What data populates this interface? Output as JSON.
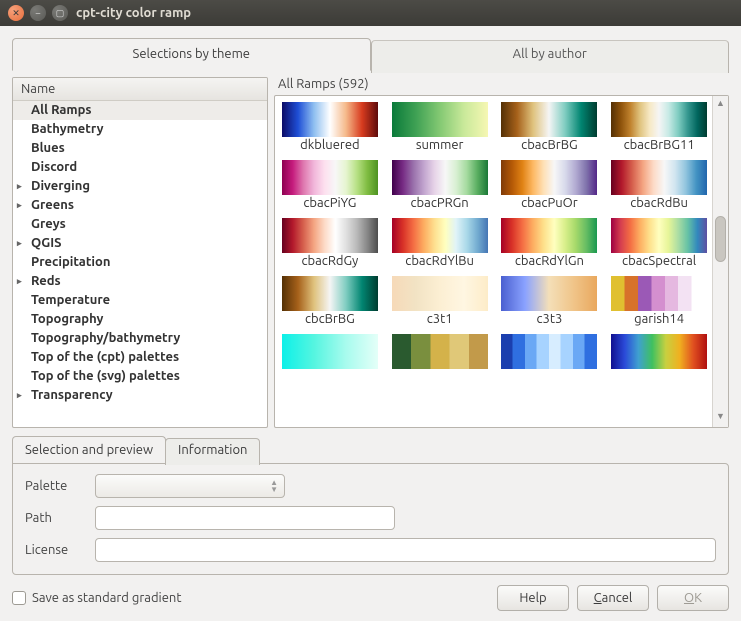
{
  "window": {
    "title": "cpt-city color ramp"
  },
  "tabs": {
    "theme": "Selections by theme",
    "author": "All by author"
  },
  "tree": {
    "header": "Name",
    "items": [
      {
        "label": "All Ramps",
        "expandable": false,
        "selected": true
      },
      {
        "label": "Bathymetry",
        "expandable": false
      },
      {
        "label": "Blues",
        "expandable": false
      },
      {
        "label": "Discord",
        "expandable": false
      },
      {
        "label": "Diverging",
        "expandable": true
      },
      {
        "label": "Greens",
        "expandable": true
      },
      {
        "label": "Greys",
        "expandable": false
      },
      {
        "label": "QGIS",
        "expandable": true
      },
      {
        "label": "Precipitation",
        "expandable": false
      },
      {
        "label": "Reds",
        "expandable": true
      },
      {
        "label": "Temperature",
        "expandable": false
      },
      {
        "label": "Topography",
        "expandable": false
      },
      {
        "label": "Topography/bathymetry",
        "expandable": false
      },
      {
        "label": "Top of the (cpt) palettes",
        "expandable": false
      },
      {
        "label": "Top of the (svg) palettes",
        "expandable": false
      },
      {
        "label": "Transparency",
        "expandable": true
      }
    ]
  },
  "grid": {
    "title": "All Ramps (592)",
    "ramps": [
      {
        "name": "dkbluered",
        "g": "linear-gradient(to right,#0b0b66,#1f4fd6,#8fbff0,#ffffff,#f5b98a,#d73b1f,#5e0b0b)"
      },
      {
        "name": "summer",
        "g": "linear-gradient(to right,#0a7a3a,#3fa154,#84c973,#c9e99a,#f6f7b3)"
      },
      {
        "name": "cbacBrBG",
        "g": "linear-gradient(to right,#543005,#a6611a,#dfc27d,#f5f5f5,#80cdc1,#018571,#003c30)"
      },
      {
        "name": "cbacBrBG11",
        "g": "linear-gradient(to right,#543005,#8c510a,#bf812d,#dfc27d,#f6e8c3,#f5f5f5,#c7eae5,#80cdc1,#35978f,#01665e,#003c30)"
      },
      {
        "name": "cbacPiYG",
        "g": "linear-gradient(to right,#8e0152,#c51b7d,#de77ae,#f1b6da,#fde0ef,#f7f7f7,#e6f5d0,#b8e186,#7fbc41,#4d9221)"
      },
      {
        "name": "cbacPRGn",
        "g": "linear-gradient(to right,#40004b,#762a83,#9970ab,#c2a5cf,#e7d4e8,#f7f7f7,#d9f0d3,#a6dba0,#5aae61,#1b7837)"
      },
      {
        "name": "cbacPuOr",
        "g": "linear-gradient(to right,#7f3b08,#b35806,#e08214,#fdb863,#fee0b6,#f7f7f7,#d8daeb,#b2abd2,#8073ac,#542788)"
      },
      {
        "name": "cbacRdBu",
        "g": "linear-gradient(to right,#67001f,#b2182b,#d6604d,#f4a582,#fddbc7,#f7f7f7,#d1e5f0,#92c5de,#4393c3,#2166ac)"
      },
      {
        "name": "cbacRdGy",
        "g": "linear-gradient(to right,#67001f,#b2182b,#d6604d,#f4a582,#fddbc7,#ffffff,#e0e0e0,#bababa,#878787,#4d4d4d)"
      },
      {
        "name": "cbacRdYlBu",
        "g": "linear-gradient(to right,#a50026,#d73027,#f46d43,#fdae61,#fee090,#ffffbf,#e0f3f8,#abd9e9,#74add1,#4575b4)"
      },
      {
        "name": "cbacRdYlGn",
        "g": "linear-gradient(to right,#a50026,#d73027,#f46d43,#fdae61,#fee08b,#ffffbf,#d9ef8b,#a6d96a,#66bd63,#1a9850)"
      },
      {
        "name": "cbacSpectral",
        "g": "linear-gradient(to right,#9e0142,#d53e4f,#f46d43,#fdae61,#fee08b,#ffffbf,#e6f598,#abdda4,#66c2a5,#3288bd,#5e4fa2)"
      },
      {
        "name": "cbcBrBG",
        "g": "linear-gradient(to right,#543005,#a6611a,#dfc27d,#f5f5f5,#80cdc1,#018571,#003c30)"
      },
      {
        "name": "c3t1",
        "g": "linear-gradient(to right,#f6d9b8,#f2e3c4,#fcefd3,#fff6e2,#fdecc8)"
      },
      {
        "name": "c3t3",
        "g": "linear-gradient(to right,#4a5fd0,#8aa2ff,#f4dfb8,#f0c58a,#e9a85e)"
      },
      {
        "name": "garish14",
        "g": "linear-gradient(to right,#e0c030 0 14%,#d7722a 14% 28%,#9b59b6 28% 42%,#d48fcf 42% 56%,#e5b8e0 56% 70%,#f3e2f3 70% 84%,#ffffff 84% 100%)"
      },
      {
        "name": "",
        "g": "linear-gradient(to right,#0cf0e8,#55f5e0,#a8fbee,#e4fff8)"
      },
      {
        "name": "",
        "g": "linear-gradient(to right,#2a5a2f 0 20%,#7a8f3e 20% 40%,#d4b24a 40% 60%,#e0c878 60% 80%,#c29a4a 80% 100%)"
      },
      {
        "name": "",
        "g": "linear-gradient(to right,#1b3fae 0 12%,#2f6fe0 12% 25%,#6aa8f5 25% 37%,#a7d3ff 37% 50%,#d7edff 50% 62%,#a7d3ff 62% 75%,#6aa8f5 75% 87%,#2f6fe0 87% 100%)"
      },
      {
        "name": "",
        "g": "linear-gradient(to right,#101090,#2a4ad8,#3fa0d0,#3fc060,#c8d040,#f0b020,#e05020,#b01010)"
      }
    ]
  },
  "subtabs": {
    "sel": "Selection and preview",
    "info": "Information"
  },
  "form": {
    "palette_label": "Palette",
    "path_label": "Path",
    "license_label": "License",
    "path_value": "",
    "license_value": ""
  },
  "footer": {
    "save_label": "Save as standard gradient",
    "help": "Help",
    "cancel": "Cancel",
    "ok": "OK"
  }
}
